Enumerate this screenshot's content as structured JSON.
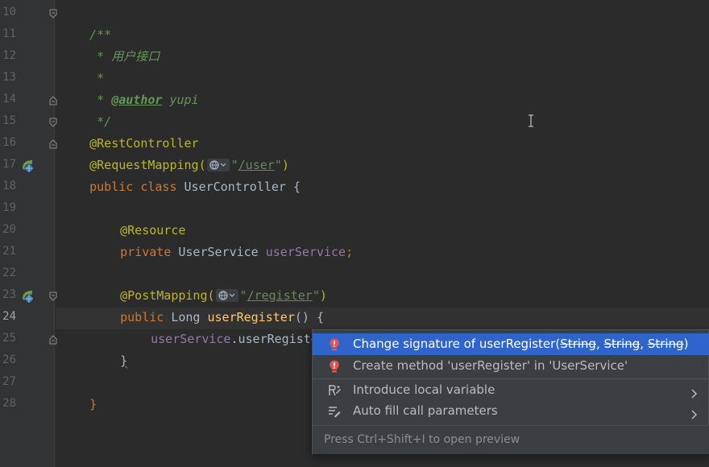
{
  "editor": {
    "current_line": 24,
    "line_numbers": [
      "10",
      "11",
      "12",
      "13",
      "14",
      "15",
      "16",
      "17",
      "18",
      "19",
      "20",
      "21",
      "22",
      "23",
      "24",
      "25",
      "26",
      "27",
      "28"
    ],
    "lines": {
      "l10": {
        "comment": "/**"
      },
      "l11": {
        "comment": " * 用户接口"
      },
      "l12": {
        "comment": " *"
      },
      "l13": {
        "comment_prefix": " * ",
        "tag": "@author",
        "comment_suffix": " yupi"
      },
      "l14": {
        "comment": " */"
      },
      "l15": {
        "annotation": "@RestController"
      },
      "l16": {
        "annotation": "@RequestMapping(",
        "string_open": "\"",
        "path": "/user",
        "string_close": "\"",
        "close": ")"
      },
      "l17": {
        "kw1": "public ",
        "kw2": "class ",
        "name": "UserController ",
        "brace": "{"
      },
      "l19": {
        "annotation": "@Resource"
      },
      "l20": {
        "kw": "private ",
        "type": "UserService ",
        "field": "userService",
        "semi": ";"
      },
      "l22": {
        "annotation": "@PostMapping(",
        "string_open": "\"",
        "path": "/register",
        "string_close": "\"",
        "close": ")"
      },
      "l23": {
        "kw": "public ",
        "type": "Long ",
        "method": "userRegister",
        "parens": "() ",
        "brace": "{"
      },
      "l24": {
        "receiver": "userService",
        "dot": ".",
        "method": "userRegister",
        "parens": "()"
      },
      "l25": {
        "brace": "}"
      },
      "l27": {
        "brace": "}"
      }
    }
  },
  "popup": {
    "items": [
      {
        "label_prefix": "Change signature of userRegister(",
        "param1": "String",
        "comma1": ", ",
        "param2": "String",
        "comma2": ", ",
        "param3": "String",
        "label_suffix": ")",
        "icon": "error-bulb-icon",
        "selected": true
      },
      {
        "label": "Create method 'userRegister' in 'UserService'",
        "icon": "error-bulb-icon"
      },
      {
        "label": "Introduce local variable",
        "icon": "introduce-variable-icon",
        "submenu": true
      },
      {
        "label": "Auto fill call parameters",
        "icon": "auto-fill-icon",
        "submenu": true
      }
    ],
    "footer": "Press Ctrl+Shift+I to open preview"
  },
  "colors": {
    "background": "#2b2b2b",
    "keyword": "#cc7832",
    "annotation": "#bbb529",
    "comment": "#629755",
    "string": "#6a8759",
    "field": "#9876aa",
    "method": "#ffc66d",
    "selection": "#2f65ca"
  }
}
